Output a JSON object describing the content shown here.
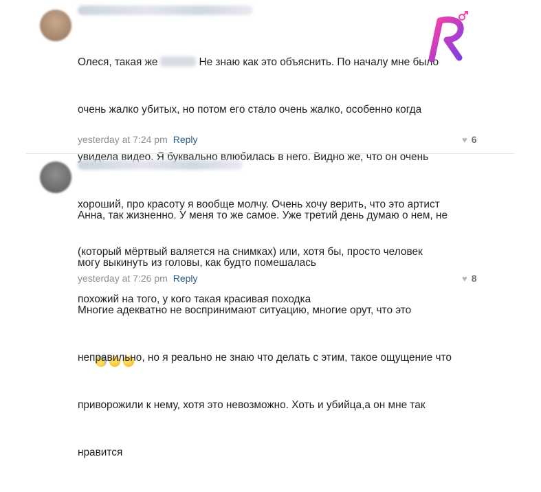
{
  "comments": [
    {
      "text_line1_before": "Олеся, такая же",
      "text_line1_after": "Не знаю как это объяснить. По началу мне было",
      "lines": [
        "очень жалко убитых, но потом его стало очень жалко, особенно когда",
        "увидела видео. Я буквально влюбилась в него. Видно же, что он очень",
        "хороший, про красоту я вообще молчу. Очень хочу верить, что это артист",
        "(который мёртвый валяется на снимках) или, хотя бы, просто человек",
        "похожий на того, у кого такая красивая походка"
      ],
      "emojis": [
        "scared-face-emoji",
        "crying-face-emoji",
        "sad-face-emoji"
      ],
      "timestamp": "yesterday at 7:24 pm",
      "reply_label": "Reply",
      "likes": "6"
    },
    {
      "lines": [
        "Анна, так жизненно. У меня то же самое. Уже третий день думаю о нем, не",
        "могу выкинуть из головы, как будто помешалась",
        "Многие адекватно не воспринимают ситуацию, многие орут, что это",
        "неправильно, но я реально не знаю что делать с этим, такое ощущение что",
        "приворожили к нему, хотя это невозможно. Хоть и убийца,а он мне так",
        "нравится"
      ],
      "timestamp": "yesterday at 7:26 pm",
      "reply_label": "Reply",
      "likes": "8"
    }
  ],
  "watermark": {
    "letter": "R",
    "icon": "brand-logo-icon",
    "colors": [
      "#ff3fa4",
      "#7b3fe4"
    ]
  },
  "colors": {
    "reply": "#2a5885",
    "meta": "#8a8f96",
    "divider": "#e7e8ec"
  }
}
